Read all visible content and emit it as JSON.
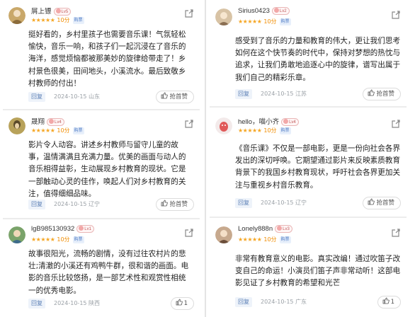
{
  "common": {
    "bought_label": "购票",
    "reply_label": "回复",
    "stars": "★★★★★"
  },
  "left": [
    {
      "username": "屑上镖",
      "level": "Lv5",
      "score": "10分",
      "text": "挺好看的，乡村里孩子也需要音乐课！气氛轻松愉快，音乐一响，和孩子们一起沉浸在了音乐的海洋，感觉烦恼都被那美妙的旋律给带走了！乡村景色很美，田间地头，小溪流水。最后致敬乡村教师的付出！",
      "date": "2024-10-15",
      "location": "山东",
      "vote": "抢首赞",
      "avatar_color": "#c9a86a"
    },
    {
      "username": "晟翔",
      "level": "Lv4",
      "score": "10分",
      "text": "影片令人动容。讲述乡村教师与留守儿童的故事，温情满满且充满力量。优美的画面与动人的音乐相得益彰，生动展现乡村教育的现状。它是一部触动心灵的佳作，唤起人们对乡村教育的关注，值得细细品味。",
      "date": "2024-10-15",
      "location": "辽宁",
      "vote": "抢首赞",
      "avatar_color": "#b8a25a"
    },
    {
      "username": "lgB985130932",
      "level": "Lv1",
      "score": "10分",
      "text": "故事很阳光，流畅的剧情，没有过往农村片的悲壮;清澈的小溪还有鸡鸭牛群，很和谐的画面。电影的音乐比较悠扬，是一部艺术性和观赏性相统一的优秀电影。",
      "date": "2024-10-15",
      "location": "陕西",
      "vote": "1",
      "avatar_color": "#7aa36a"
    }
  ],
  "right": [
    {
      "username": "Sirius0423",
      "level": "Lv2",
      "score": "10分",
      "text": "感受到了音乐的力量和教育的伟大，更让我们思考如何在这个快节奏的时代中，保持对梦想的热忱与追求，让我们勇敢地追逐心中的旋律，谱写出属于我们自己的精彩乐章。",
      "date": "2024-10-15",
      "location": "江苏",
      "vote": "抢首赞",
      "avatar_color": "#d8c3a5"
    },
    {
      "username": "hello，喵小齐",
      "level": "Lv4",
      "score": "10分",
      "text": "《音乐课》不仅是一部电影，更是一份向社会各界发出的深切呼唤。它期望通过影片来反映素质教育背景下的我国乡村教育现状，呼吁社会各界更加关注与重视乡村音乐教育。",
      "date": "2024-10-15",
      "location": "辽宁",
      "vote": "抢首赞",
      "avatar_color": "#e05a5a"
    },
    {
      "username": "Lonely888n",
      "level": "Lv3",
      "score": "10分",
      "text": "非常有教育意义的电影。真实改编！通过吹笛子改变自己的命运！小演员们笛子声非常动听！这部电影见证了乡村教育的希望和光芒",
      "date": "2024-10-15",
      "location": "广东",
      "vote": "1",
      "avatar_color": "#c7a98e"
    }
  ]
}
